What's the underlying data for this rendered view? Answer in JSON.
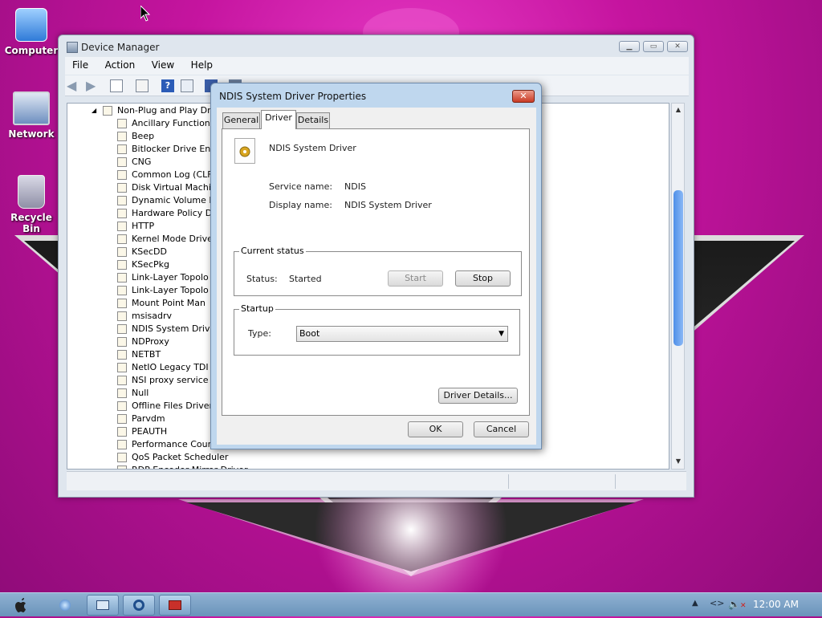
{
  "desktop": {
    "icons": [
      {
        "label": "Computer"
      },
      {
        "label": "Network"
      },
      {
        "label": "Recycle Bin"
      }
    ]
  },
  "device_manager": {
    "title": "Device Manager",
    "menu": [
      "File",
      "Action",
      "View",
      "Help"
    ],
    "tree_parent": "Non-Plug and Play Dr",
    "tree_items": [
      "Ancillary Function",
      "Beep",
      "Bitlocker Drive Enc",
      "CNG",
      "Common Log (CLF",
      "Disk Virtual Machi",
      "Dynamic Volume M",
      "Hardware Policy D",
      "HTTP",
      "Kernel Mode Drive",
      "KSecDD",
      "KSecPkg",
      "Link-Layer Topolo",
      "Link-Layer Topolo",
      "Mount Point Man",
      "msisadrv",
      "NDIS System Drive",
      "NDProxy",
      "NETBT",
      "NetIO Legacy TDI S",
      "NSI proxy service d",
      "Null",
      "Offline Files Driver",
      "Parvdm",
      "PEAUTH",
      "Performance Cour",
      "QoS Packet Scheduler",
      "RDP Encoder Mirror Driver"
    ]
  },
  "dialog": {
    "title": "NDIS System Driver Properties",
    "tabs": [
      "General",
      "Driver",
      "Details"
    ],
    "active_tab": "Driver",
    "device_name": "NDIS System Driver",
    "service_name_label": "Service name:",
    "service_name_value": "NDIS",
    "display_name_label": "Display name:",
    "display_name_value": "NDIS System Driver",
    "current_status_title": "Current status",
    "status_label": "Status:",
    "status_value": "Started",
    "start_label": "Start",
    "stop_label": "Stop",
    "startup_title": "Startup",
    "type_label": "Type:",
    "type_value": "Boot",
    "driver_details_label": "Driver Details...",
    "ok_label": "OK",
    "cancel_label": "Cancel",
    "close_glyph": "✕"
  },
  "taskbar": {
    "clock": "12:00 AM"
  }
}
